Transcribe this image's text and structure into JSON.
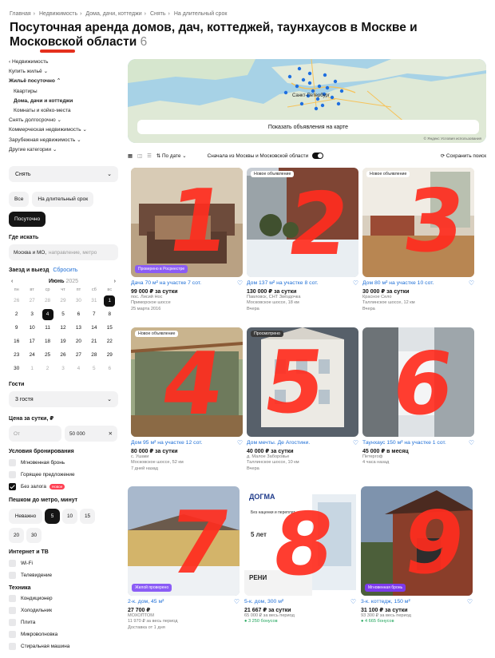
{
  "breadcrumbs": [
    "Главная",
    "Недвижимость",
    "Дома, дачи, коттеджи",
    "Снять",
    "На длительный срок"
  ],
  "page_title": "Посуточная аренда домов, дач, коттеджей, таунхаусов в Москве и Московской области",
  "result_count": "6",
  "sidebar": {
    "back_label": "‹ Недвижимость",
    "nav": [
      "Купить жильё",
      "Жильё посуточно",
      "Квартиры",
      "Дома, дачи и коттеджи",
      "Комнаты и койко-места",
      "Снять долгосрочно",
      "Коммерческая недвижимость",
      "Зарубежная недвижимость",
      "Другие категории"
    ],
    "deal_select": "Снять",
    "rent_pills": [
      "Все",
      "На длительный срок",
      "Посуточно"
    ],
    "where_label": "Где искать",
    "where_value": "Москва и МО,",
    "where_placeholder": "направление, метро",
    "dates_label": "Заезд и выезд",
    "dates_reset": "Сбросить",
    "calendar": {
      "month": "Июнь",
      "year": "2025",
      "weekdays": [
        "пн",
        "вт",
        "ср",
        "чт",
        "пт",
        "сб",
        "вс"
      ],
      "rows": [
        [
          "26",
          "27",
          "28",
          "29",
          "30",
          "31",
          "1"
        ],
        [
          "2",
          "3",
          "4",
          "5",
          "6",
          "7",
          "8"
        ],
        [
          "9",
          "10",
          "11",
          "12",
          "13",
          "14",
          "15"
        ],
        [
          "16",
          "17",
          "18",
          "19",
          "20",
          "21",
          "22"
        ],
        [
          "23",
          "24",
          "25",
          "26",
          "27",
          "28",
          "29"
        ],
        [
          "30",
          "1",
          "2",
          "3",
          "4",
          "5",
          "6"
        ]
      ]
    },
    "guests_label": "Гости",
    "guests_value": "3 гостя",
    "price_label": "Цена за сутки, ₽",
    "price_from": "От",
    "price_to": "50 000",
    "booking_label": "Условия бронирования",
    "booking": [
      "Мгновенная бронь",
      "Горящее предложение",
      "Без залога"
    ],
    "new_badge": "Новое",
    "metro_label": "Пешком до метро, минут",
    "metro": [
      "Неважно",
      "5",
      "10",
      "15",
      "20",
      "30"
    ],
    "internet_label": "Интернет и ТВ",
    "internet": [
      "Wi-Fi",
      "Телевидение"
    ],
    "tech_label": "Техника",
    "tech": [
      "Кондиционер",
      "Холодильник",
      "Плита",
      "Микроволновка",
      "Стиральная машина"
    ]
  },
  "map": {
    "button": "Показать объявления на карте",
    "city": "Санкт-Петербург",
    "note": "© Яндекс Условия использования"
  },
  "toolbar": {
    "sort": "По дате",
    "msk_toggle": "Сначала из Москвы и Московской области",
    "save": "Сохранить поиск"
  },
  "listings": [
    {
      "n": "1",
      "tag": "",
      "promo": "Проверено в Росреестре",
      "title": "Дача 70 м² на участке 7 сот.",
      "price": "99 000 ₽ за сутки",
      "sub1": "пос. Лисий Нос",
      "sub2": "Приморское шоссе",
      "sub3": "25 марта 2016",
      "sub4": ""
    },
    {
      "n": "2",
      "tag": "Новое объявление",
      "promo": "",
      "title": "Дом 137 м² на участке 8 сот.",
      "price": "130 000 ₽ за сутки",
      "sub1": "Павловск, СНТ Звёздочка",
      "sub2": "Московское шоссе, 18 км",
      "sub3": "Вчера",
      "sub4": ""
    },
    {
      "n": "3",
      "tag": "Новое объявление",
      "promo": "",
      "title": "Дом 80 м² на участке 10 сот.",
      "price": "30 000 ₽ за сутки",
      "sub1": "Красное Село",
      "sub2": "Таллинское шоссе, 12 км",
      "sub3": "Вчера",
      "sub4": ""
    },
    {
      "n": "4",
      "tag": "Новое объявление",
      "promo": "",
      "title": "Дом 95 м² на участке 12 сот.",
      "price": "80 000 ₽ за сутки",
      "sub1": "с. Ушаки",
      "sub2": "Московское шоссе, 52 км",
      "sub3": "7 дней назад",
      "sub4": ""
    },
    {
      "n": "5",
      "tag": "Просмотрено",
      "promo": "",
      "title": "Дом мечты. Де Агостини.",
      "price": "40 000 ₽ за сутки",
      "sub1": "д. Малое Заборовье",
      "sub2": "Таллинское шоссе, 10 км",
      "sub3": "Вчера",
      "sub4": ""
    },
    {
      "n": "6",
      "tag": "",
      "promo": "",
      "title": "Таунхаус 150 м² на участке 1 сот.",
      "price": "45 000 ₽ в месяц",
      "sub1": "Петергоф",
      "sub2": "4 часа назад",
      "sub3": "",
      "sub4": ""
    },
    {
      "n": "7",
      "tag": "",
      "promo": "Жилой проверено",
      "title": "2-к. дом, 45 м²",
      "price": "27 700 ₽",
      "sub1": "МОХОПТОМ",
      "sub2": "11 970 ₽ за весь период",
      "sub3": "Доставка от 1 дня",
      "sub4": ""
    },
    {
      "n": "8",
      "tag": "",
      "promo": "",
      "title": "5-к. дом, 300 м²",
      "price": "21 667 ₽ за сутки",
      "sub1": "65 000 ₽ за весь период",
      "sub2": "3 250 бонусов",
      "sub3": "",
      "sub4": "",
      "ad": {
        "brand": "ДОГМА",
        "line1": "Без наценки и переплат",
        "line2": "5 лет",
        "line3": "РЕНИ"
      }
    },
    {
      "n": "9",
      "tag": "",
      "promo": "Мгновенная бронь",
      "title": "3-к. коттедж, 150 м²",
      "price": "31 100 ₽ за сутки",
      "sub1": "93 300 ₽ за весь период",
      "sub2": "4 665 бонусов",
      "sub3": "",
      "sub4": ""
    }
  ]
}
